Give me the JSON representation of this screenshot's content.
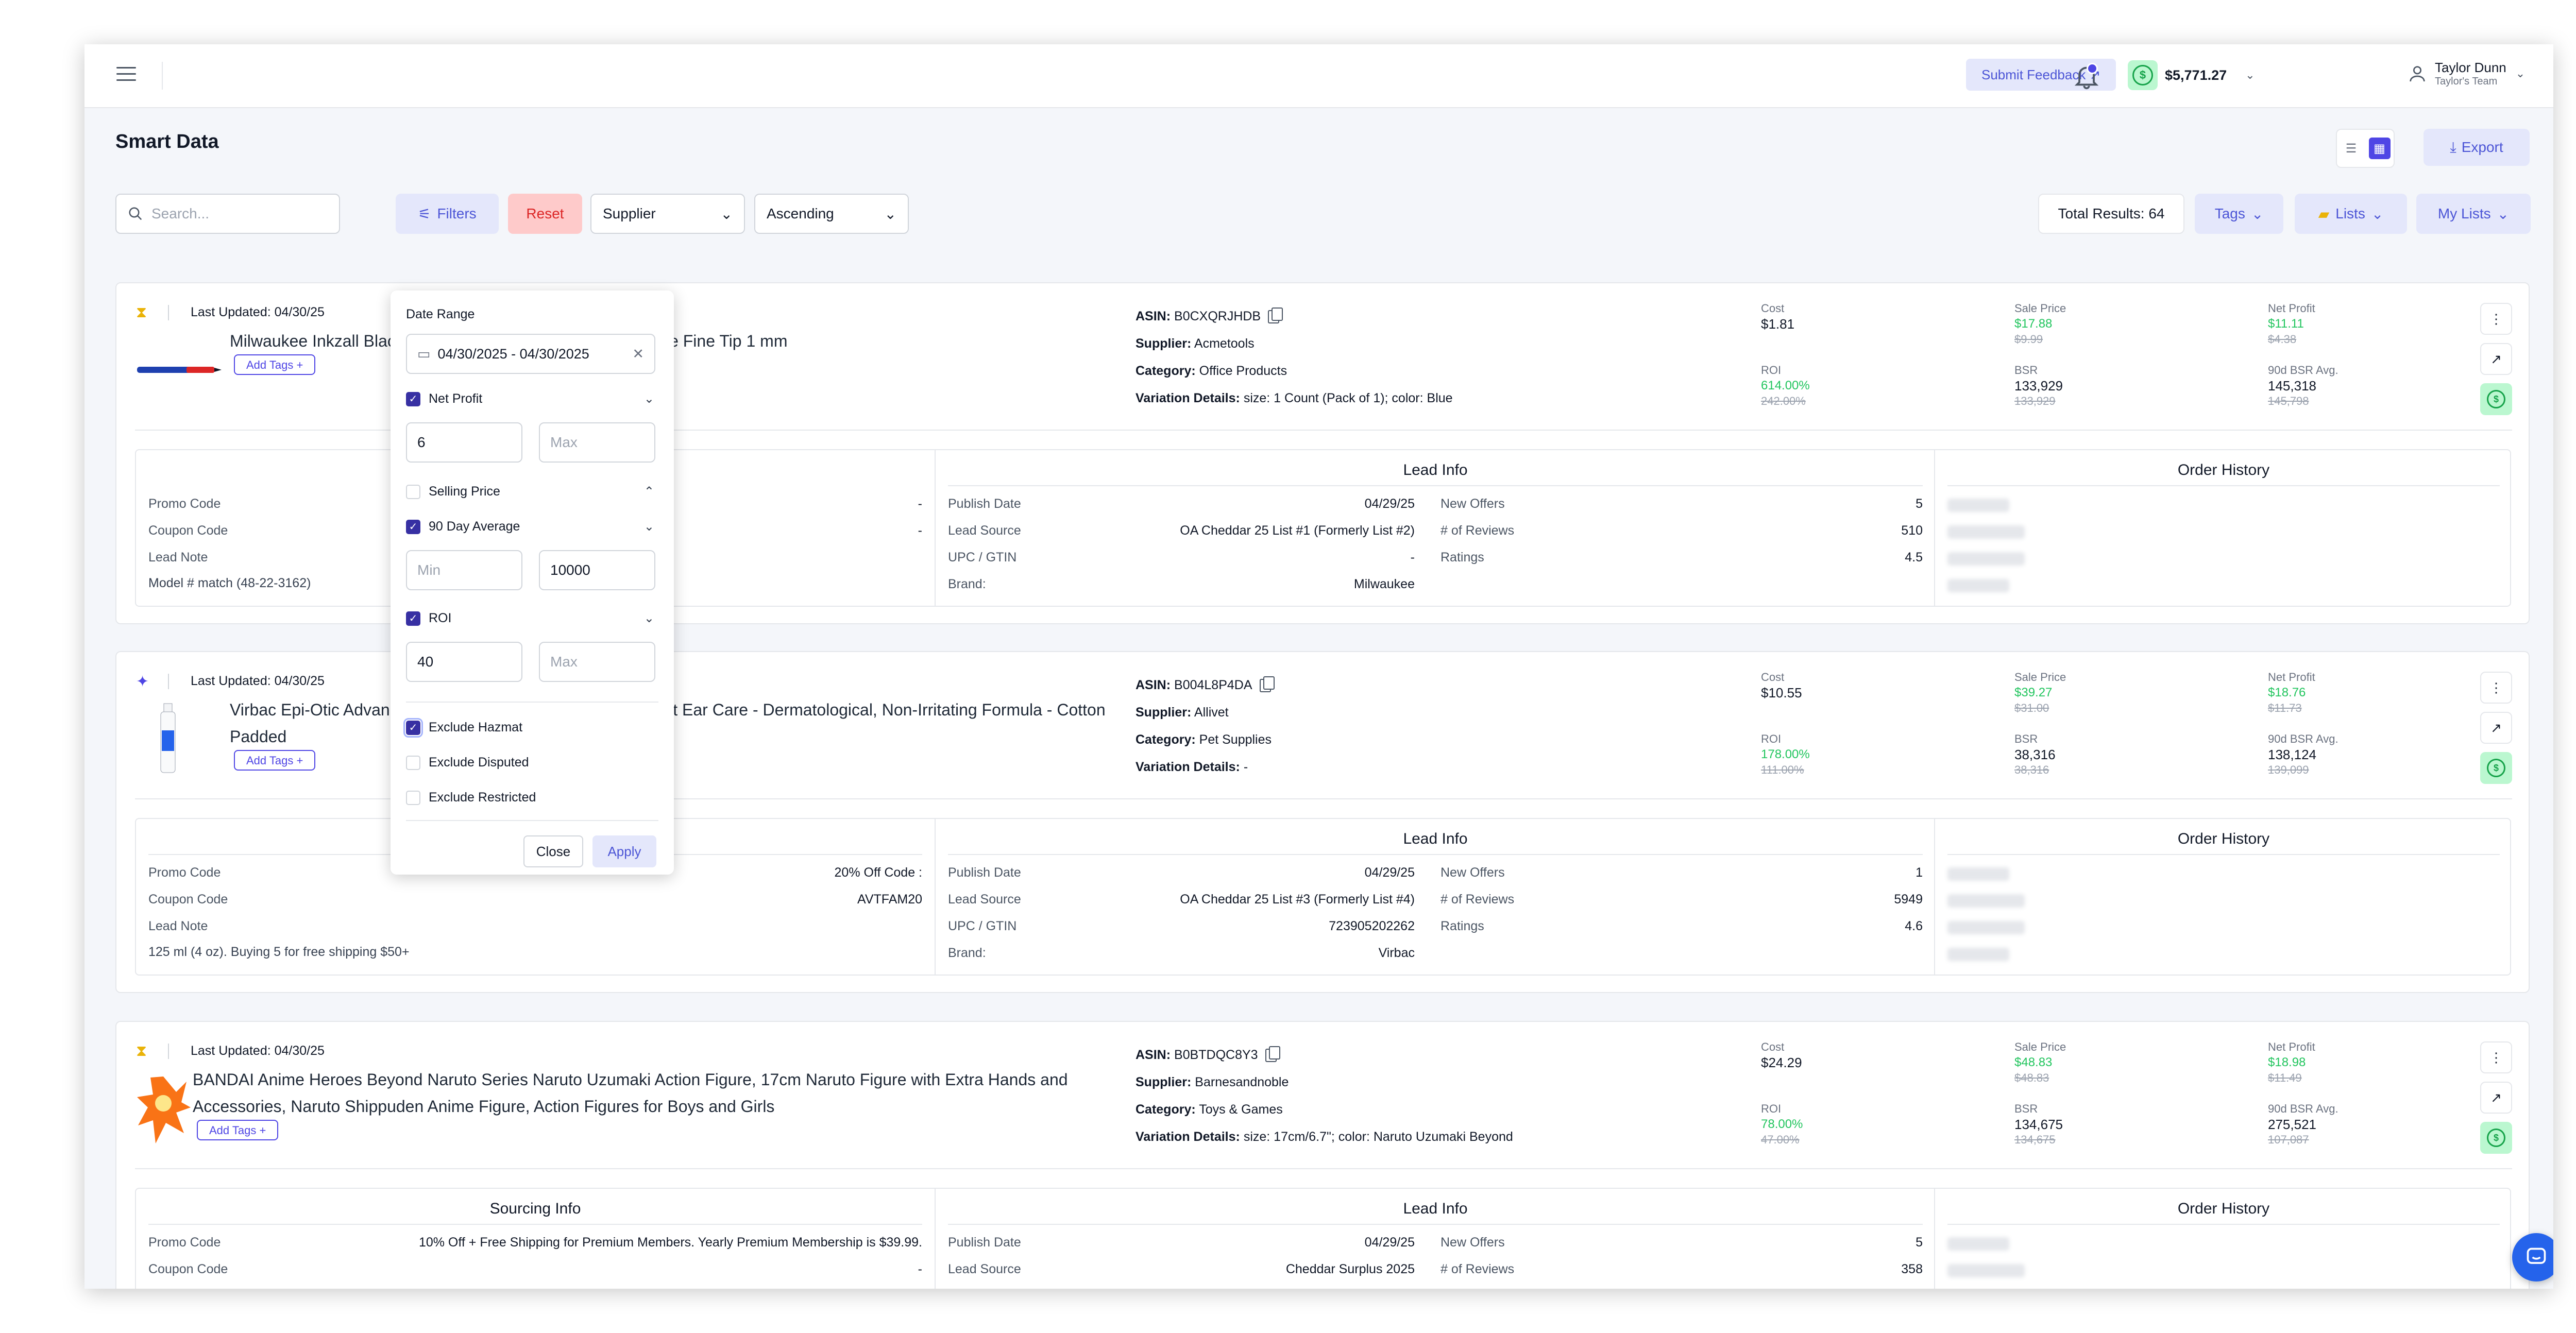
{
  "header": {
    "feedback_label": "Submit Feedback",
    "balance": "$5,771.27",
    "user_name": "Taylor Dunn",
    "user_team": "Taylor's Team"
  },
  "page": {
    "title": "Smart Data",
    "export_label": "Export"
  },
  "toolbar": {
    "search_placeholder": "Search...",
    "filters_label": "Filters",
    "reset_label": "Reset",
    "supplier_value": "Supplier",
    "order_value": "Ascending",
    "total_results": "Total Results: 64",
    "tags_label": "Tags",
    "lists_label": "Lists",
    "my_lists_label": "My Lists"
  },
  "filter_panel": {
    "date_range_label": "Date Range",
    "date_range_value": "04/30/2025 - 04/30/2025",
    "net_profit": {
      "label": "Net Profit",
      "checked": true,
      "min": "6",
      "max_placeholder": "Max"
    },
    "selling_price": {
      "label": "Selling Price",
      "checked": false
    },
    "ninety_day": {
      "label": "90 Day Average",
      "checked": true,
      "min_placeholder": "Min",
      "max": "10000"
    },
    "roi": {
      "label": "ROI",
      "checked": true,
      "min": "40",
      "max_placeholder": "Max"
    },
    "exclude_hazmat": {
      "label": "Exclude Hazmat",
      "checked": true
    },
    "exclude_disputed": {
      "label": "Exclude Disputed",
      "checked": false
    },
    "exclude_restricted": {
      "label": "Exclude Restricted",
      "checked": false
    },
    "close_label": "Close",
    "apply_label": "Apply"
  },
  "labels": {
    "last_updated": "Last Updated:",
    "add_tags": "Add Tags",
    "asin": "ASIN:",
    "supplier": "Supplier:",
    "category": "Category:",
    "variation": "Variation Details:",
    "cost": "Cost",
    "sale_price": "Sale Price",
    "net_profit": "Net Profit",
    "roi": "ROI",
    "bsr": "BSR",
    "bsr_avg": "90d BSR Avg.",
    "sourcing_info": "Sourcing Info",
    "lead_info": "Lead Info",
    "order_history": "Order History",
    "promo_code": "Promo Code",
    "coupon_code": "Coupon Code",
    "lead_note": "Lead Note",
    "publish_date": "Publish Date",
    "lead_source": "Lead Source",
    "upc": "UPC / GTIN",
    "brand": "Brand:",
    "new_offers": "New Offers",
    "reviews": "# of Reviews",
    "ratings": "Ratings"
  },
  "products": [
    {
      "updated": "04/30/25",
      "title": "Milwaukee Inkzall Black Fine Point Marker Felt Tip Pen Office Fine Tip 1 mm",
      "asin": "B0CXQRJHDB",
      "supplier": "Acmetools",
      "category": "Office Products",
      "variation": "size: 1 Count (Pack of 1); color: Blue",
      "cost": "$1.81",
      "sale_price": "$17.88",
      "sale_price_old": "$9.99",
      "net_profit": "$11.11",
      "net_profit_old": "$4.38",
      "roi": "614.00%",
      "roi_old": "242.00%",
      "bsr": "133,929",
      "bsr_old": "133,929",
      "bsr_avg": "145,318",
      "bsr_avg_old": "145,798",
      "promo_code": "-",
      "coupon_code": "-",
      "lead_note": "Model # match (48-22-3162)",
      "publish_date": "04/29/25",
      "lead_source": "OA Cheddar 25 List #1 (Formerly List #2)",
      "upc": "-",
      "brand": "Milwaukee",
      "new_offers": "5",
      "reviews": "510",
      "ratings": "4.5"
    },
    {
      "updated": "04/30/25",
      "title": "Virbac Epi-Otic Advanced Ear Cleanser for Dogs & Cats - Pet Ear Care - Dermatological, Non-Irritating Formula - Cotton Padded",
      "asin": "B004L8P4DA",
      "supplier": "Allivet",
      "category": "Pet Supplies",
      "variation": "-",
      "cost": "$10.55",
      "sale_price": "$39.27",
      "sale_price_old": "$31.00",
      "net_profit": "$18.76",
      "net_profit_old": "$11.73",
      "roi": "178.00%",
      "roi_old": "111.00%",
      "bsr": "38,316",
      "bsr_old": "38,316",
      "bsr_avg": "138,124",
      "bsr_avg_old": "139,099",
      "promo_code": "20% Off Code :",
      "coupon_code": "AVTFAM20",
      "lead_note": "125 ml (4 oz). Buying 5 for free shipping $50+",
      "publish_date": "04/29/25",
      "lead_source": "OA Cheddar 25 List #3 (Formerly List #4)",
      "upc": "723905202262",
      "brand": "Virbac",
      "new_offers": "1",
      "reviews": "5949",
      "ratings": "4.6"
    },
    {
      "updated": "04/30/25",
      "title": "BANDAI Anime Heroes Beyond Naruto Series Naruto Uzumaki Action Figure, 17cm Naruto Figure with Extra Hands and Accessories, Naruto Shippuden Anime Figure, Action Figures for Boys and Girls",
      "asin": "B0BTDQC8Y3",
      "supplier": "Barnesandnoble",
      "category": "Toys & Games",
      "variation": "size: 17cm/6.7\"; color: Naruto Uzumaki Beyond",
      "cost": "$24.29",
      "sale_price": "$48.83",
      "sale_price_old": "$48.83",
      "net_profit": "$18.98",
      "net_profit_old": "$11.49",
      "roi": "78.00%",
      "roi_old": "47.00%",
      "bsr": "134,675",
      "bsr_old": "134,675",
      "bsr_avg": "275,521",
      "bsr_avg_old": "107,087",
      "promo_code": "10% Off + Free Shipping for Premium Members. Yearly Premium Membership is $39.99.",
      "coupon_code": "-",
      "publish_date": "04/29/25",
      "lead_source": "Cheddar Surplus 2025",
      "new_offers": "5",
      "reviews": "358"
    }
  ]
}
